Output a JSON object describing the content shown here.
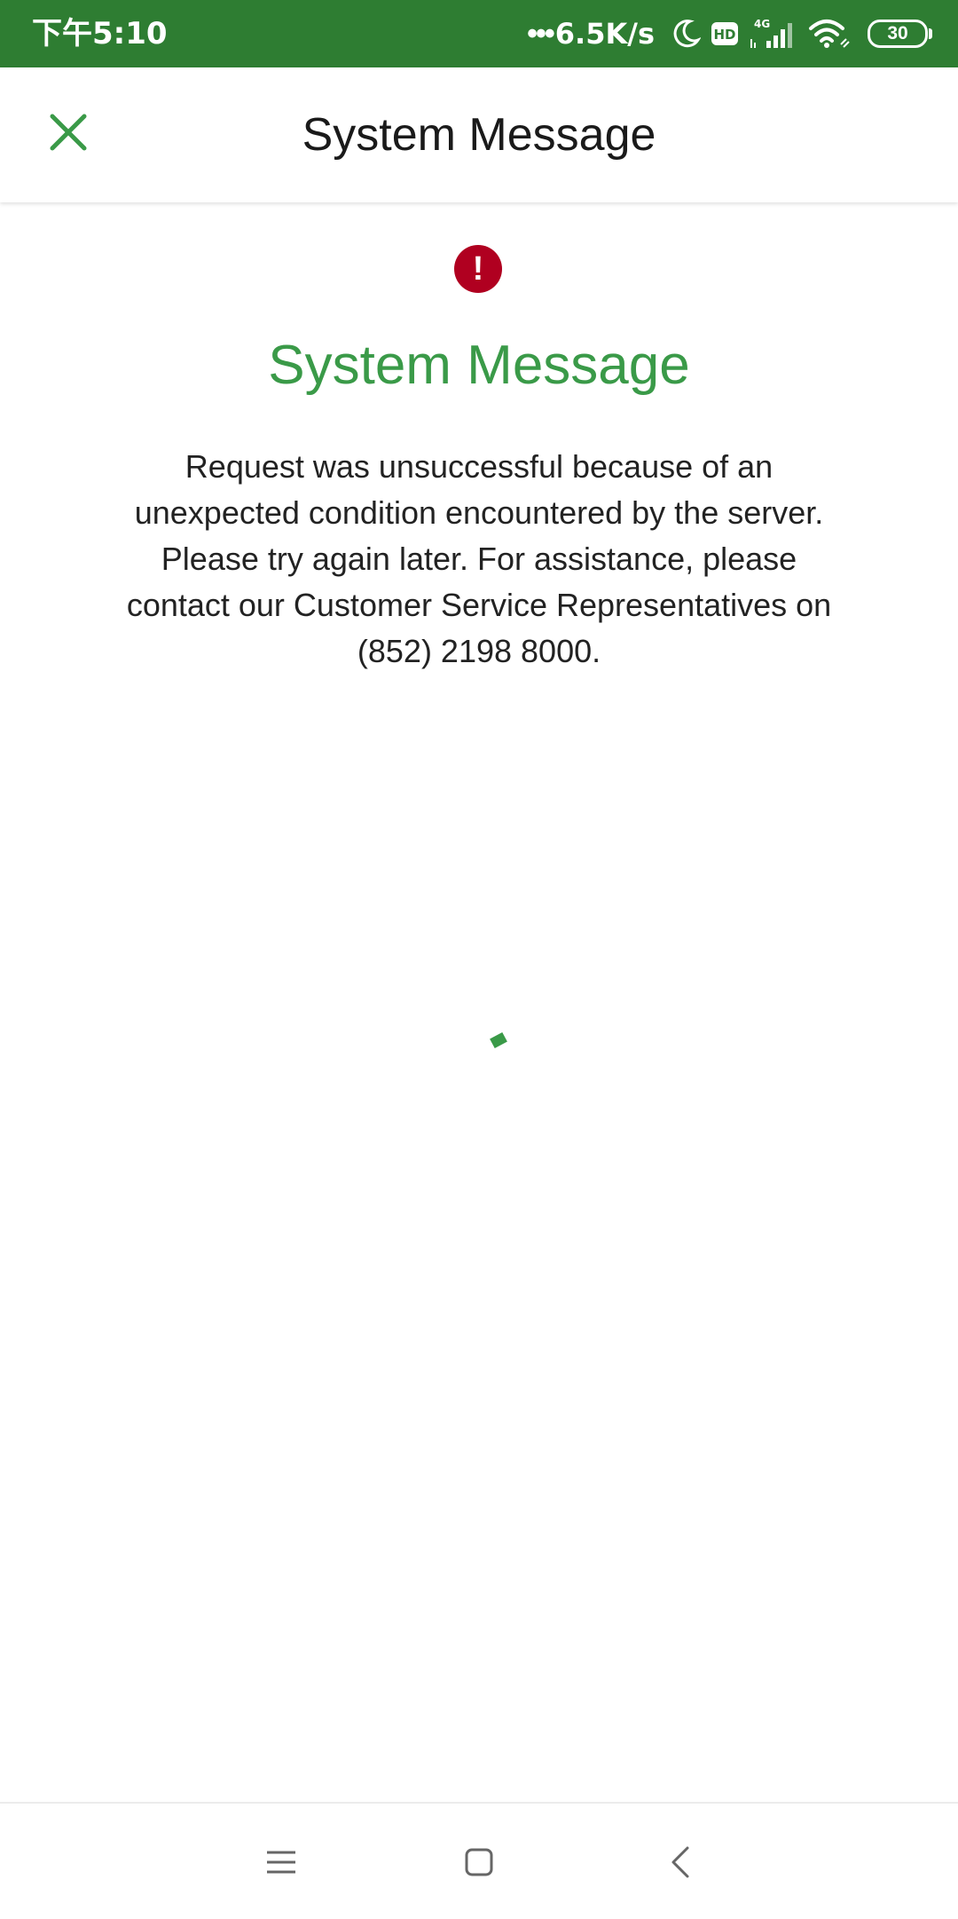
{
  "status_bar": {
    "time": "下午5:10",
    "net_dots": "•••",
    "net_speed": "6.5K/s",
    "hd_label": "HD",
    "signal_label": "4G",
    "battery_level": "30",
    "background_color": "#2e7d32",
    "icons": [
      "moon-icon",
      "hd-icon",
      "signal-icon",
      "wifi-icon",
      "battery-icon"
    ]
  },
  "app_bar": {
    "title": "System Message",
    "close_icon": "close-icon",
    "accent_color": "#3a9a48"
  },
  "message": {
    "icon": "error-icon",
    "icon_glyph": "!",
    "icon_color": "#b00020",
    "heading": "System Message",
    "heading_color": "#3a9a48",
    "body": "Request was unsuccessful because of an unexpected condition encountered by the server. Please try again later. For assistance, please contact our Customer Service Representatives on (852) 2198 8000."
  },
  "loading": {
    "icon": "loading-spinner-icon"
  },
  "nav_bar": {
    "buttons": [
      "menu-icon",
      "home-icon",
      "back-icon"
    ]
  }
}
